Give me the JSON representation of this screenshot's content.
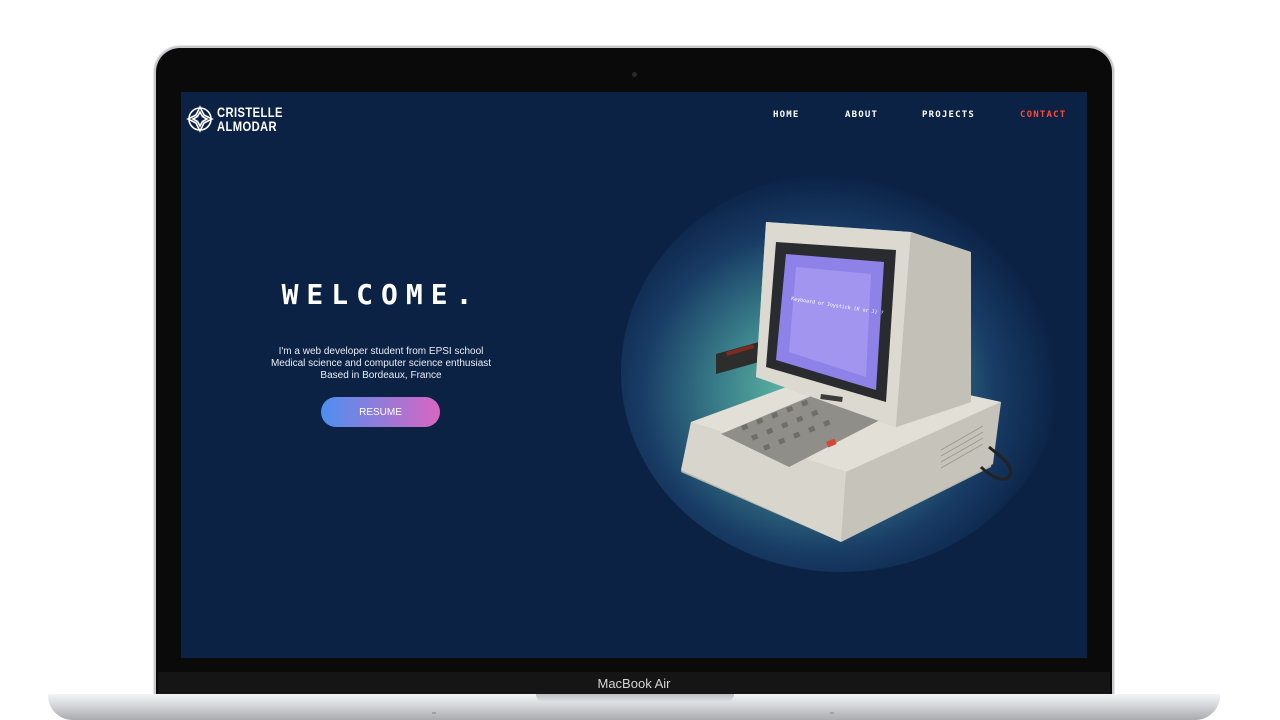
{
  "device": {
    "model_label": "MacBook Air"
  },
  "site": {
    "logo": {
      "line1": "CRISTELLE",
      "line2": "ALMODAR"
    },
    "nav": [
      {
        "label": "HOME",
        "active": false
      },
      {
        "label": "ABOUT",
        "active": false
      },
      {
        "label": "PROJECTS",
        "active": false
      },
      {
        "label": "CONTACT",
        "active": true
      }
    ],
    "hero": {
      "title": "WELCOME.",
      "lines": [
        "I'm a web developer student from EPSI school",
        "Medical science and computer science enthusiast",
        "Based in Bordeaux, France"
      ],
      "button_label": "RESUME"
    }
  },
  "colors": {
    "background": "#0b2245",
    "accent": "#ff4a3a",
    "button_gradient_start": "#4d8ff0",
    "button_gradient_end": "#d966c2"
  },
  "illustration": {
    "name": "retro-computer-illustration"
  }
}
